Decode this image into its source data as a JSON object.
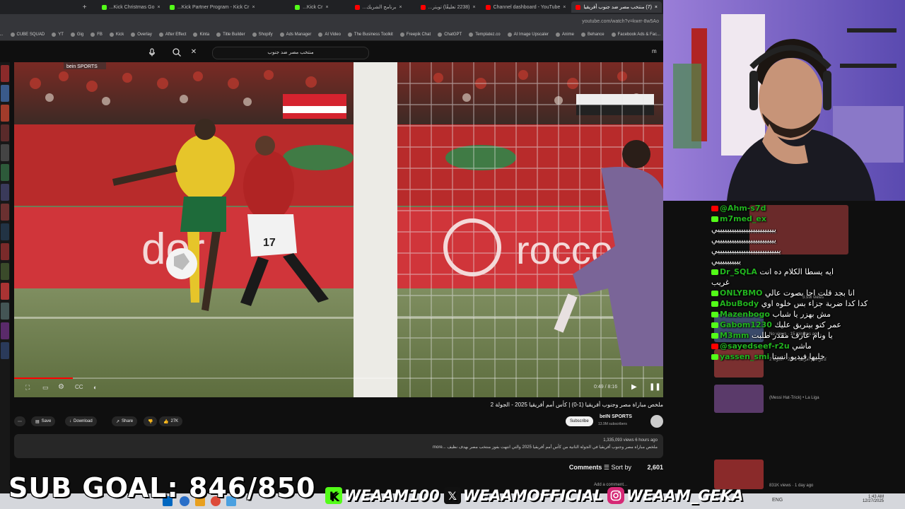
{
  "browser": {
    "tabs": [
      {
        "title": "Kick Christmas Go...",
        "color": "#53fc18"
      },
      {
        "title": "Kick Partner Program - Kick Cr...",
        "color": "#53fc18"
      },
      {
        "title": "Kick Cr...",
        "color": "#53fc18"
      },
      {
        "title": "برنامج الشريك...",
        "color": "#ff0000"
      },
      {
        "title": "(2238 تعليقًا) تويتر...",
        "color": "#ff0000"
      },
      {
        "title": "Channel dashboard - YouTube",
        "color": "#ff0000"
      },
      {
        "title": "(7) منتخب مصر ضد جنوب أفريقيا",
        "color": "#ff0000",
        "active": true
      }
    ],
    "url": "youtube.com/watch?v=kwrr-8w5Ao",
    "bookmarks": [
      "Facebook Ads & Fac...",
      "Behance",
      "Anime",
      "AI Image Upscaler",
      "Templatez.co",
      "ChatGPT",
      "Freepik Chat",
      "The Business Toolkit",
      "AI Video",
      "Ads Manager",
      "Shopify",
      "Title Builder",
      "Kinta",
      "After Effect",
      "Overlay",
      "Kick",
      "FB",
      "Gig",
      "YT",
      "CUBE SQUAD",
      "RC - MCHF - EEfect..."
    ]
  },
  "youtube": {
    "search_text": "منتخب مصر ضد جنوب",
    "video": {
      "title": "ملخص مباراة مصر وجنوب أفريقيا (1-0) | كأس أمم أفريقيا 2025 - الجولة 2",
      "channel": "beIN SPORTS",
      "subscribers": "13.9M subscribers",
      "subscribe_label": "Subscribe",
      "likes": "27K",
      "share_label": "Share",
      "download_label": "Download",
      "save_label": "Save",
      "views": "1,335,093 views  6 hours ago",
      "description": "ملخص مباراة مصر وجنوب أفريقيا في الجولة الثانية من كأس أمم أفريقيا 2025 والتي انتهت بفوز منتخب مصر بهدف نظيف ...more",
      "time": "0:49 / 8:16",
      "progress_pct": 9,
      "broadcaster": "bein SPORTS",
      "board_text_left": "dor",
      "board_text_right": "rocco  K"
    },
    "comments_count": "2,601 Comments",
    "sort_by": "Sort by",
    "add_comment": "Add a comment..."
  },
  "chat": {
    "messages": [
      {
        "platform": "youtube",
        "user": "@Ahm-s7d",
        "text": ""
      },
      {
        "platform": "kick",
        "user": "m7med_ex",
        "text": ""
      },
      {
        "platform": "none",
        "user": "",
        "text": "يييييييييييييييييييييييييي"
      },
      {
        "platform": "none",
        "user": "",
        "text": "يييييييييييييييييييييييييي"
      },
      {
        "platform": "none",
        "user": "",
        "text": "يييييييييييييييييييييييييييي"
      },
      {
        "platform": "none",
        "user": "",
        "text": "ييييييييييي"
      },
      {
        "platform": "kick",
        "user": "Dr_SQLA",
        "text": "ايه يسطا الكلام ده انت"
      },
      {
        "platform": "none",
        "user": "",
        "text": "غريب"
      },
      {
        "platform": "kick",
        "user": "ONLYBMO",
        "text": "انا بجد قلت اجا بصوت عالي"
      },
      {
        "platform": "kick",
        "user": "AbuBody",
        "text": "كدا كدا ضربة جزاء بس خلوه اوي"
      },
      {
        "platform": "kick",
        "user": "Mazenbogo",
        "text": "مش بهزر يا شباب"
      },
      {
        "platform": "kick",
        "user": "Gabom1230",
        "text": "عمر كتو بيتريق عليك"
      },
      {
        "platform": "kick",
        "user": "M3mm",
        "text": "يا ونام عارف مقدر طلبت"
      },
      {
        "platform": "youtube",
        "user": "@sayedseef-r2u",
        "text": "ماشي"
      },
      {
        "platform": "kick",
        "user": "yassen_smi",
        "text": "خليها فيديو انستا"
      }
    ],
    "suggestions": [
      {
        "meta": "3.9M views"
      },
      {
        "meta": "No views · 15 minutes ago"
      },
      {
        "meta": "كأس أمم أفريقيا 2025 - الجولة 2"
      },
      {
        "meta": "(Messi Hat-Trick) • La Liga"
      },
      {
        "meta": "831K views · 1 day ago"
      }
    ]
  },
  "overlay": {
    "sub_goal_label": "SUB GOAL: 846/850",
    "kick_handle": "WEAAM100",
    "x_handle": "WEAAMOFFICIAL",
    "instagram_handle": "WEAAM_GEKA",
    "kick_color": "#53fc18",
    "x_color": "#111111",
    "instagram_color": "#d62976"
  },
  "taskbar": {
    "time": "1:43 AM",
    "date": "12/27/2025",
    "lang": "ENG"
  }
}
